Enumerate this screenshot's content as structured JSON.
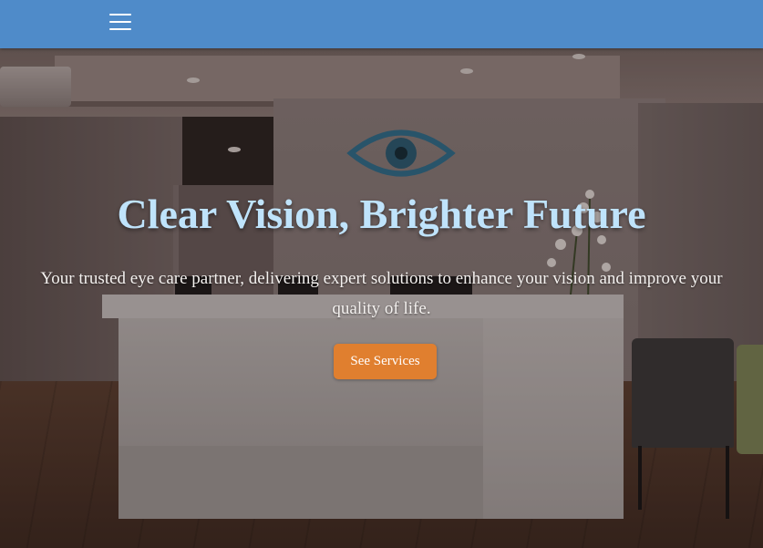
{
  "header": {
    "menu_icon": "hamburger-menu-icon",
    "background_color": "#4f8bc9"
  },
  "hero": {
    "title": "Clear Vision, Brighter Future",
    "subtitle": "Your trusted eye care partner, delivering expert solutions to enhance your vision and improve your quality of life.",
    "cta_label": "See Services",
    "title_color": "#bfe3fb",
    "cta_color": "#e07f2f",
    "background_image": "eye-clinic-reception-photo"
  }
}
